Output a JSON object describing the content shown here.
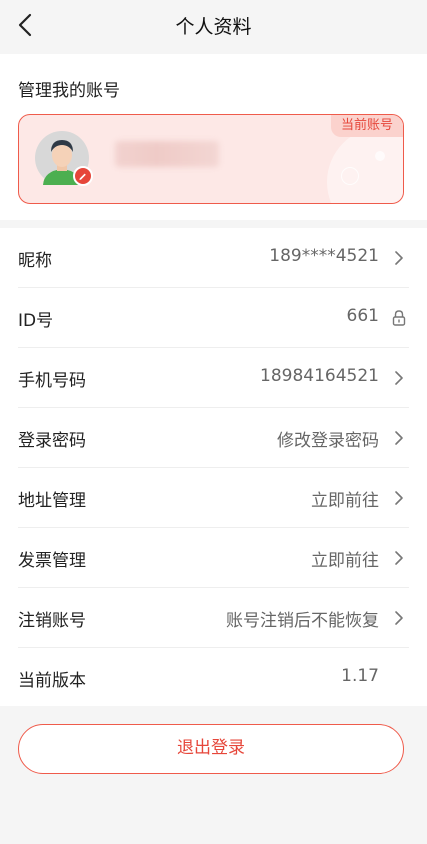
{
  "header": {
    "title": "个人资料"
  },
  "account": {
    "section_label": "管理我的账号",
    "current_badge": "当前账号"
  },
  "rows": [
    {
      "label": "昵称",
      "value": "189****4521"
    },
    {
      "label": "ID号",
      "value": "661"
    },
    {
      "label": "手机号码",
      "value": "18984164521"
    },
    {
      "label": "登录密码",
      "value": "修改登录密码"
    },
    {
      "label": "地址管理",
      "value": "立即前往"
    },
    {
      "label": "发票管理",
      "value": "立即前往"
    },
    {
      "label": "注销账号",
      "value": "账号注销后不能恢复"
    },
    {
      "label": "当前版本",
      "value": "1.17"
    }
  ],
  "logout_label": "退出登录",
  "colors": {
    "accent": "#e6463a",
    "accent_bg": "#fde8e6",
    "page_bg": "#f5f5f5"
  }
}
